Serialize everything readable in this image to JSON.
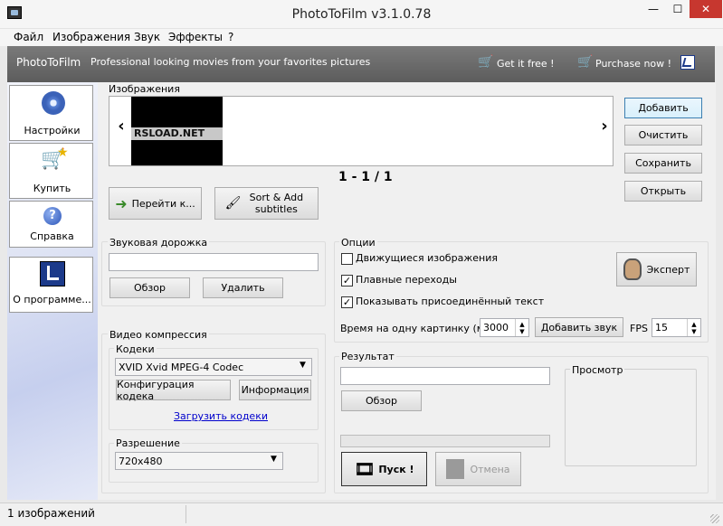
{
  "titlebar": {
    "title": "PhotoToFilm v3.1.0.78",
    "min": "—",
    "max": "☐",
    "close": "✕"
  },
  "menu": [
    "Файл",
    "Изображения",
    "Звук",
    "Эффекты",
    "?"
  ],
  "banner": {
    "brand": "PhotoToFilm",
    "tagline": "Professional looking movies from your favorites pictures",
    "get_free": "Get it free !",
    "purchase": "Purchase now !"
  },
  "sidebar": [
    {
      "label": "Настройки",
      "icon": "gear-icon"
    },
    {
      "label": "Купить",
      "icon": "cart-star-icon"
    },
    {
      "label": "Справка",
      "icon": "help-icon"
    },
    {
      "label": "О программе...",
      "icon": "about-logo-icon"
    }
  ],
  "images": {
    "title": "Изображения",
    "thumb_text": "RSLOAD.NET",
    "counter": "1 - 1 / 1",
    "prev": "‹",
    "next": "›",
    "goto": "Перейти к...",
    "sort_add": "Sort & Add subtitles"
  },
  "side_buttons": [
    "Добавить",
    "Очистить",
    "Сохранить",
    "Открыть"
  ],
  "audio": {
    "title": "Звуковая дорожка",
    "value": "",
    "browse": "Обзор",
    "delete": "Удалить"
  },
  "video": {
    "title": "Видео компрессия",
    "codecs_title": "Кодеки",
    "codec": "XVID Xvid MPEG-4 Codec",
    "config": "Конфигурация кодека",
    "info": "Информация",
    "download": "Загрузить кодеки",
    "res_title": "Разрешение",
    "resolution": "720x480"
  },
  "options": {
    "title": "Опции",
    "moving": "Движущиеся изображения",
    "moving_checked": false,
    "smooth": "Плавные переходы",
    "smooth_checked": true,
    "show_text": "Показывать присоединённый текст",
    "show_text_checked": true,
    "expert": "Эксперт",
    "time_label": "Время на одну картинку (мс) :",
    "time_value": "3000",
    "add_sound": "Добавить звук",
    "fps_label": "FPS",
    "fps_value": "15"
  },
  "result": {
    "title": "Результат",
    "value": "",
    "browse": "Обзор",
    "preview": "Просмотр",
    "start": "Пуск !",
    "cancel": "Отмена",
    "progress": 0
  },
  "status": {
    "text": "1 изображений"
  },
  "colors": {
    "banner": "#6a6a6a",
    "link": "#0000cc",
    "titlebar": "#f5f5f5"
  }
}
